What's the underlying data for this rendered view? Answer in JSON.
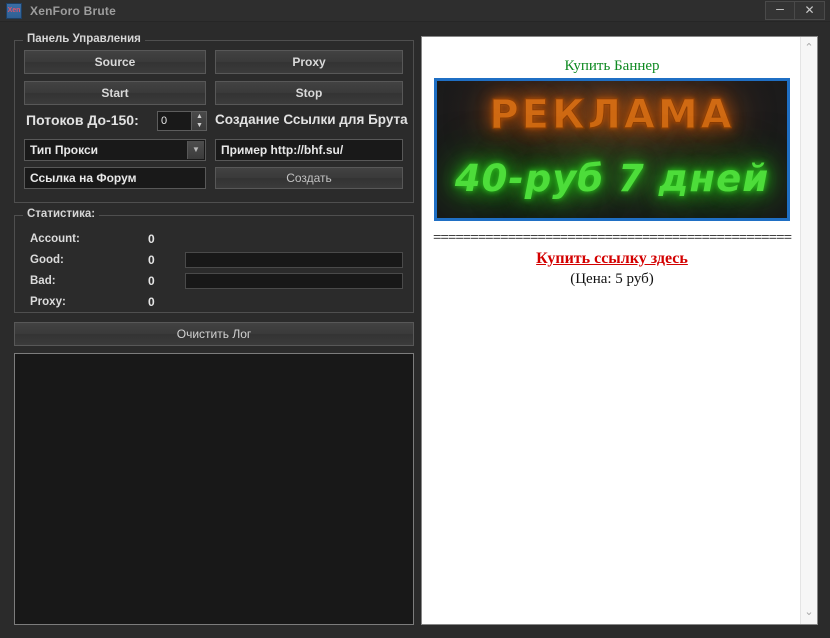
{
  "window": {
    "title": "XenForo Brute",
    "icon_label": "Xen",
    "minimize_label": "–",
    "close_label": "✕"
  },
  "control_panel": {
    "legend": "Панель Управления",
    "source_label": "Source",
    "proxy_label": "Proxy",
    "start_label": "Start",
    "stop_label": "Stop",
    "threads_label": "Потоков До-150:",
    "threads_value": "0",
    "spin_up": "▲",
    "spin_down": "▼",
    "make_link_label": "Создание Ссылки для Брута",
    "proxy_type_value": "Тип Прокси",
    "proxy_type_arrow": "▼",
    "example_value": "Пример http://bhf.su/",
    "forum_link_value": "Ссылка на Форум",
    "create_label": "Создать"
  },
  "statistics": {
    "legend": "Статистика:",
    "rows": [
      {
        "label": "Account:",
        "value": "0"
      },
      {
        "label": "Good:",
        "value": "0"
      },
      {
        "label": "Bad:",
        "value": "0"
      },
      {
        "label": "Proxy:",
        "value": "0"
      }
    ]
  },
  "log": {
    "clear_label": "Очистить Лог",
    "content": ""
  },
  "ad_panel": {
    "title": "Купить Баннер",
    "banner_line1": "РЕКЛАМА",
    "banner_line2": "40-руб 7 дней",
    "separator": "================================================",
    "buy_link": "Купить ссылку здесь",
    "price": "(Цена: 5 руб)",
    "scroll_up": "⌃",
    "scroll_down": "⌄"
  },
  "colors": {
    "accent_blue": "#1f6fc4",
    "ad_green": "#0f8a22",
    "buy_red": "#d30000",
    "banner_orange": "#d06a13",
    "banner_green": "#4ddd3a"
  }
}
